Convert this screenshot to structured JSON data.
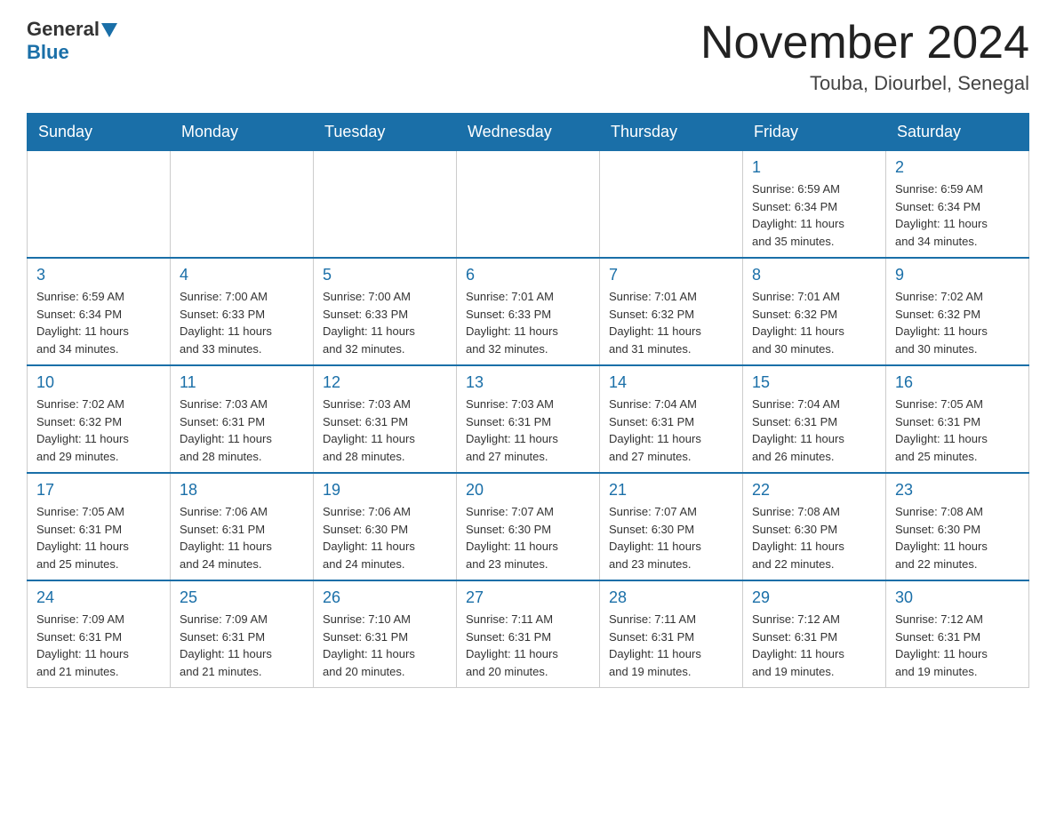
{
  "header": {
    "logo_general": "General",
    "logo_blue": "Blue",
    "month_title": "November 2024",
    "location": "Touba, Diourbel, Senegal"
  },
  "weekdays": [
    "Sunday",
    "Monday",
    "Tuesday",
    "Wednesday",
    "Thursday",
    "Friday",
    "Saturday"
  ],
  "weeks": [
    {
      "days": [
        {
          "num": "",
          "info": ""
        },
        {
          "num": "",
          "info": ""
        },
        {
          "num": "",
          "info": ""
        },
        {
          "num": "",
          "info": ""
        },
        {
          "num": "",
          "info": ""
        },
        {
          "num": "1",
          "info": "Sunrise: 6:59 AM\nSunset: 6:34 PM\nDaylight: 11 hours\nand 35 minutes."
        },
        {
          "num": "2",
          "info": "Sunrise: 6:59 AM\nSunset: 6:34 PM\nDaylight: 11 hours\nand 34 minutes."
        }
      ]
    },
    {
      "days": [
        {
          "num": "3",
          "info": "Sunrise: 6:59 AM\nSunset: 6:34 PM\nDaylight: 11 hours\nand 34 minutes."
        },
        {
          "num": "4",
          "info": "Sunrise: 7:00 AM\nSunset: 6:33 PM\nDaylight: 11 hours\nand 33 minutes."
        },
        {
          "num": "5",
          "info": "Sunrise: 7:00 AM\nSunset: 6:33 PM\nDaylight: 11 hours\nand 32 minutes."
        },
        {
          "num": "6",
          "info": "Sunrise: 7:01 AM\nSunset: 6:33 PM\nDaylight: 11 hours\nand 32 minutes."
        },
        {
          "num": "7",
          "info": "Sunrise: 7:01 AM\nSunset: 6:32 PM\nDaylight: 11 hours\nand 31 minutes."
        },
        {
          "num": "8",
          "info": "Sunrise: 7:01 AM\nSunset: 6:32 PM\nDaylight: 11 hours\nand 30 minutes."
        },
        {
          "num": "9",
          "info": "Sunrise: 7:02 AM\nSunset: 6:32 PM\nDaylight: 11 hours\nand 30 minutes."
        }
      ]
    },
    {
      "days": [
        {
          "num": "10",
          "info": "Sunrise: 7:02 AM\nSunset: 6:32 PM\nDaylight: 11 hours\nand 29 minutes."
        },
        {
          "num": "11",
          "info": "Sunrise: 7:03 AM\nSunset: 6:31 PM\nDaylight: 11 hours\nand 28 minutes."
        },
        {
          "num": "12",
          "info": "Sunrise: 7:03 AM\nSunset: 6:31 PM\nDaylight: 11 hours\nand 28 minutes."
        },
        {
          "num": "13",
          "info": "Sunrise: 7:03 AM\nSunset: 6:31 PM\nDaylight: 11 hours\nand 27 minutes."
        },
        {
          "num": "14",
          "info": "Sunrise: 7:04 AM\nSunset: 6:31 PM\nDaylight: 11 hours\nand 27 minutes."
        },
        {
          "num": "15",
          "info": "Sunrise: 7:04 AM\nSunset: 6:31 PM\nDaylight: 11 hours\nand 26 minutes."
        },
        {
          "num": "16",
          "info": "Sunrise: 7:05 AM\nSunset: 6:31 PM\nDaylight: 11 hours\nand 25 minutes."
        }
      ]
    },
    {
      "days": [
        {
          "num": "17",
          "info": "Sunrise: 7:05 AM\nSunset: 6:31 PM\nDaylight: 11 hours\nand 25 minutes."
        },
        {
          "num": "18",
          "info": "Sunrise: 7:06 AM\nSunset: 6:31 PM\nDaylight: 11 hours\nand 24 minutes."
        },
        {
          "num": "19",
          "info": "Sunrise: 7:06 AM\nSunset: 6:30 PM\nDaylight: 11 hours\nand 24 minutes."
        },
        {
          "num": "20",
          "info": "Sunrise: 7:07 AM\nSunset: 6:30 PM\nDaylight: 11 hours\nand 23 minutes."
        },
        {
          "num": "21",
          "info": "Sunrise: 7:07 AM\nSunset: 6:30 PM\nDaylight: 11 hours\nand 23 minutes."
        },
        {
          "num": "22",
          "info": "Sunrise: 7:08 AM\nSunset: 6:30 PM\nDaylight: 11 hours\nand 22 minutes."
        },
        {
          "num": "23",
          "info": "Sunrise: 7:08 AM\nSunset: 6:30 PM\nDaylight: 11 hours\nand 22 minutes."
        }
      ]
    },
    {
      "days": [
        {
          "num": "24",
          "info": "Sunrise: 7:09 AM\nSunset: 6:31 PM\nDaylight: 11 hours\nand 21 minutes."
        },
        {
          "num": "25",
          "info": "Sunrise: 7:09 AM\nSunset: 6:31 PM\nDaylight: 11 hours\nand 21 minutes."
        },
        {
          "num": "26",
          "info": "Sunrise: 7:10 AM\nSunset: 6:31 PM\nDaylight: 11 hours\nand 20 minutes."
        },
        {
          "num": "27",
          "info": "Sunrise: 7:11 AM\nSunset: 6:31 PM\nDaylight: 11 hours\nand 20 minutes."
        },
        {
          "num": "28",
          "info": "Sunrise: 7:11 AM\nSunset: 6:31 PM\nDaylight: 11 hours\nand 19 minutes."
        },
        {
          "num": "29",
          "info": "Sunrise: 7:12 AM\nSunset: 6:31 PM\nDaylight: 11 hours\nand 19 minutes."
        },
        {
          "num": "30",
          "info": "Sunrise: 7:12 AM\nSunset: 6:31 PM\nDaylight: 11 hours\nand 19 minutes."
        }
      ]
    }
  ]
}
